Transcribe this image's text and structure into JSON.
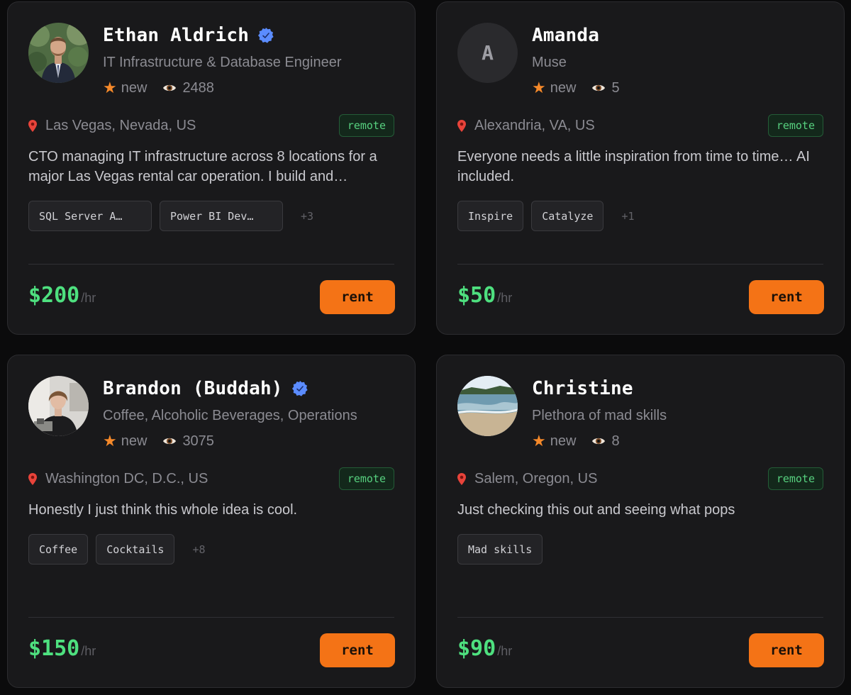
{
  "cards": [
    {
      "name": "Ethan Aldrich",
      "verified": true,
      "avatar": "photo-man-in-suit",
      "subtitle": "IT Infrastructure & Database Engineer",
      "rating_label": "new",
      "views": "2488",
      "location": "Las Vegas, Nevada, US",
      "remote_label": "remote",
      "description": "CTO managing IT infrastructure across 8 locations for a major Las Vegas rental car operation. I build and…",
      "tags": [
        "SQL Server A…",
        "Power BI Dev…"
      ],
      "more_tags": "+3",
      "price": "$200",
      "price_unit": "/hr",
      "rent_label": "rent"
    },
    {
      "name": "Amanda",
      "verified": false,
      "avatar_initial": "A",
      "subtitle": "Muse",
      "rating_label": "new",
      "views": "5",
      "location": "Alexandria, VA, US",
      "remote_label": "remote",
      "description": "Everyone needs a little inspiration from time to time… AI included.",
      "tags": [
        "Inspire",
        "Catalyze"
      ],
      "more_tags": "+1",
      "price": "$50",
      "price_unit": "/hr",
      "rent_label": "rent"
    },
    {
      "name": "Brandon (Buddah)",
      "verified": true,
      "avatar": "photo-man-at-bar",
      "subtitle": "Coffee, Alcoholic Beverages, Operations",
      "rating_label": "new",
      "views": "3075",
      "location": "Washington DC, D.C., US",
      "remote_label": "remote",
      "description": "Honestly I just think this whole idea is cool.",
      "tags": [
        "Coffee",
        "Cocktails"
      ],
      "more_tags": "+8",
      "price": "$150",
      "price_unit": "/hr",
      "rent_label": "rent"
    },
    {
      "name": "Christine",
      "verified": false,
      "avatar": "photo-beach-shore",
      "subtitle": "Plethora of mad skills",
      "rating_label": "new",
      "views": "8",
      "location": "Salem, Oregon, US",
      "remote_label": "remote",
      "description": "Just checking this out and seeing what pops",
      "tags": [
        "Mad skills"
      ],
      "more_tags": "",
      "price": "$90",
      "price_unit": "/hr",
      "rent_label": "rent"
    }
  ],
  "colors": {
    "accent_orange": "#f47316",
    "price_green": "#4ee07f",
    "remote_green": "#57d17f",
    "verified_blue": "#5b8cff",
    "star_orange": "#f5892a"
  }
}
